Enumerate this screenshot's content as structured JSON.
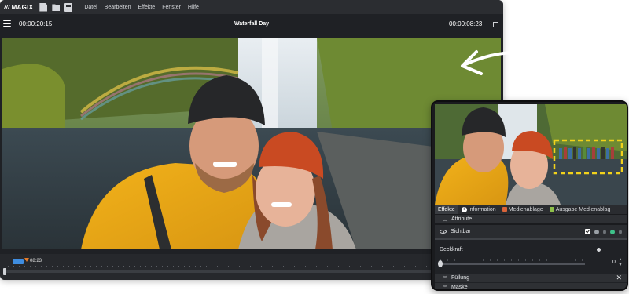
{
  "app": {
    "brand": "MAGIX",
    "menu": [
      "Datei",
      "Bearbeiten",
      "Effekte",
      "Fenster",
      "Hilfe"
    ]
  },
  "player": {
    "position_time": "00:00:20:15",
    "project_title": "Waterfall Day",
    "duration_time": "00:00:08:23"
  },
  "timeline": {
    "marker_time": "08:23"
  },
  "panel": {
    "tabs": [
      {
        "label": "Effekte",
        "active": true
      },
      {
        "label": "Information",
        "icon": "info-icon"
      },
      {
        "label": "Medienablage",
        "icon": "media-pool-icon"
      },
      {
        "label": "Ausgabe Medienablag",
        "icon": "output-media-icon"
      }
    ],
    "sections": {
      "attributes": "Attribute",
      "visible": "Sichtbar",
      "opacity_label": "Deckkraft",
      "opacity_value": "0",
      "fill": "Füllung",
      "mask": "Maske"
    }
  },
  "colors": {
    "accent_blue": "#3f8de0",
    "marker_orange": "#e07a2b",
    "selection_yellow": "#f2d21b"
  }
}
